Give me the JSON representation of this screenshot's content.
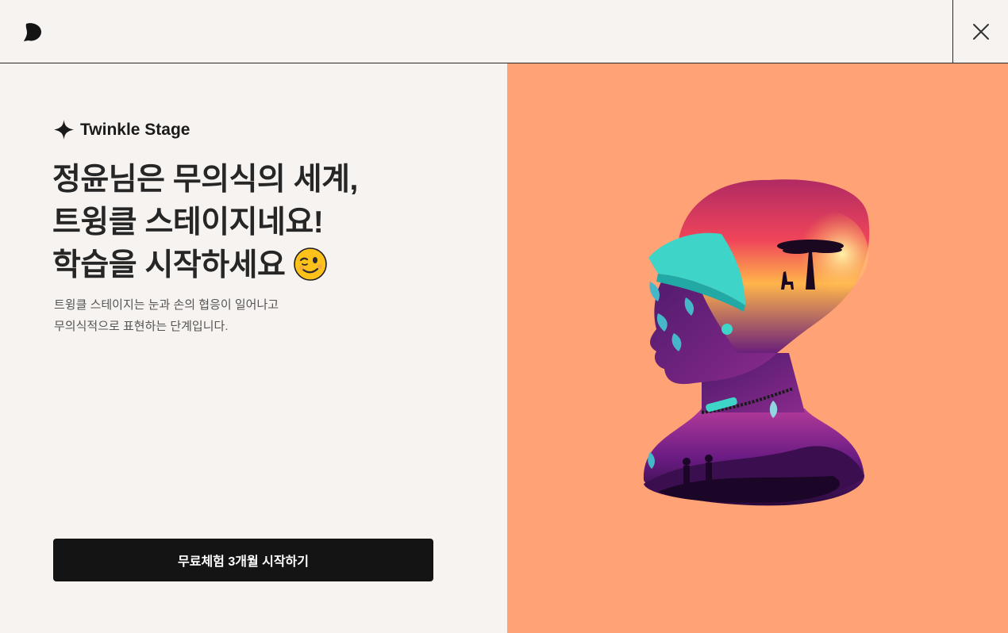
{
  "header": {
    "logo_icon": "brand-logo-icon",
    "close_icon": "close-icon"
  },
  "intro": {
    "badge_icon": "sparkle-icon",
    "badge_label": "Twinkle Stage",
    "headline_lines": [
      "정윤님은 무의식의 세계,",
      "트윙클 스테이지네요!",
      "학습을 시작하세요"
    ],
    "headline_emoji_icon": "winking-face-icon",
    "description_lines": [
      "트윙클 스테이지는 눈과 손의 협응이 일어나고",
      "무의식적으로 표현하는 단계입니다."
    ],
    "cta_label": "무료체험 3개월 시작하기"
  },
  "illustration": {
    "icon": "woman-silhouette-savanna-illustration",
    "background_color": "#ffa275"
  }
}
